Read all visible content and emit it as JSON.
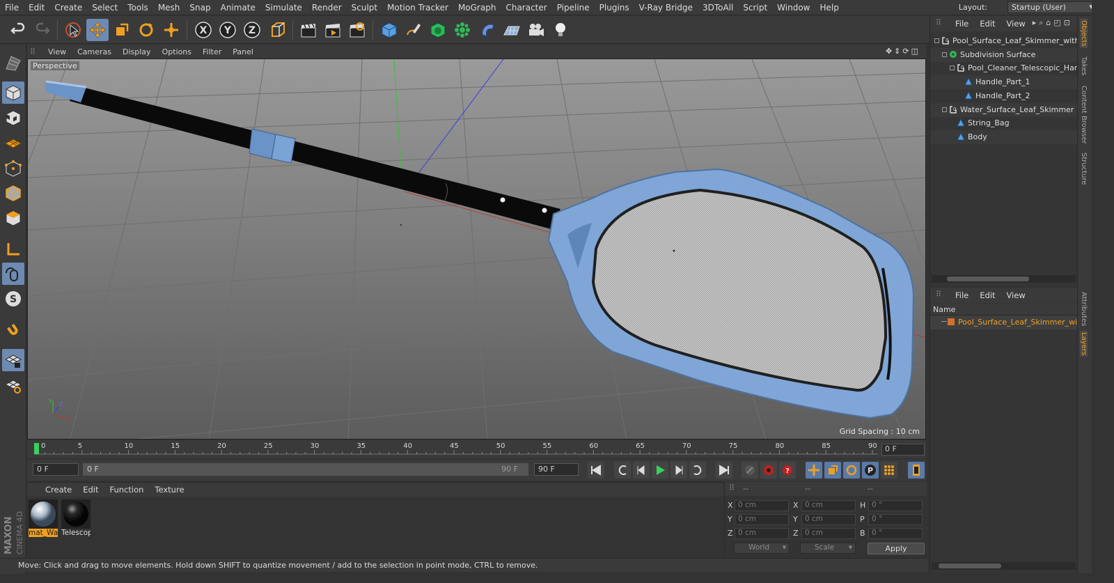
{
  "menu": [
    "File",
    "Edit",
    "Create",
    "Select",
    "Tools",
    "Mesh",
    "Snap",
    "Animate",
    "Simulate",
    "Render",
    "Sculpt",
    "Motion Tracker",
    "MoGraph",
    "Character",
    "Pipeline",
    "Plugins",
    "V-Ray Bridge",
    "3DToAll",
    "Script",
    "Window",
    "Help"
  ],
  "layout": {
    "label": "Layout:",
    "value": "Startup (User)"
  },
  "viewport": {
    "menu": [
      "View",
      "Cameras",
      "Display",
      "Options",
      "Filter",
      "Panel"
    ],
    "label": "Perspective",
    "grid_spacing": "Grid Spacing : 10 cm"
  },
  "timeline": {
    "ticks": [
      "0",
      "5",
      "10",
      "15",
      "20",
      "25",
      "30",
      "35",
      "40",
      "45",
      "50",
      "55",
      "60",
      "65",
      "70",
      "75",
      "80",
      "85",
      "90"
    ],
    "current_frame": "0 F"
  },
  "transport": {
    "start": "0 F",
    "range_start": "0 F",
    "range_end": "90 F",
    "end": "90 F"
  },
  "materials": {
    "menu": [
      "Create",
      "Edit",
      "Function",
      "Texture"
    ],
    "items": [
      {
        "label": "mat_Wa",
        "selected": true
      },
      {
        "label": "Telescop",
        "selected": false
      }
    ]
  },
  "coords": {
    "head": [
      "--",
      "--",
      "--"
    ],
    "rows": [
      {
        "a": "X",
        "av": "0 cm",
        "b": "X",
        "bv": "0 cm",
        "c": "H",
        "cv": "0 °"
      },
      {
        "a": "Y",
        "av": "0 cm",
        "b": "Y",
        "bv": "0 cm",
        "c": "P",
        "cv": "0 °"
      },
      {
        "a": "Z",
        "av": "0 cm",
        "b": "Z",
        "bv": "0 cm",
        "c": "B",
        "cv": "0 °"
      }
    ],
    "mode1": "World",
    "mode2": "Scale",
    "apply": "Apply"
  },
  "status": "Move: Click and drag to move elements. Hold down SHIFT to quantize movement / add to the selection in point mode, CTRL to remove.",
  "objects": {
    "menu": [
      "File",
      "Edit",
      "View"
    ],
    "tree": [
      {
        "label": "Pool_Surface_Leaf_Skimmer_with_H",
        "icon": "null"
      },
      {
        "label": "Subdivision Surface",
        "icon": "subdiv"
      },
      {
        "label": "Pool_Cleaner_Telescopic_Hand",
        "icon": "null"
      },
      {
        "label": "Handle_Part_1",
        "icon": "poly"
      },
      {
        "label": "Handle_Part_2",
        "icon": "poly"
      },
      {
        "label": "Water_Surface_Leaf_Skimmer",
        "icon": "null"
      },
      {
        "label": "String_Bag",
        "icon": "poly"
      },
      {
        "label": "Body",
        "icon": "poly"
      }
    ]
  },
  "layers": {
    "menu": [
      "File",
      "Edit",
      "View"
    ],
    "column": "Name",
    "items": [
      "Pool_Surface_Leaf_Skimmer_with_"
    ]
  },
  "side_tabs": [
    "Objects",
    "Takes",
    "Content Browser",
    "Structure",
    "Attributes",
    "Layers"
  ],
  "brand": [
    "MAXON",
    "CINEMA 4D"
  ],
  "colors": {
    "accent": "#6d8ab3",
    "selection": "#f0a020",
    "object_blue": "#7fa6d6"
  }
}
